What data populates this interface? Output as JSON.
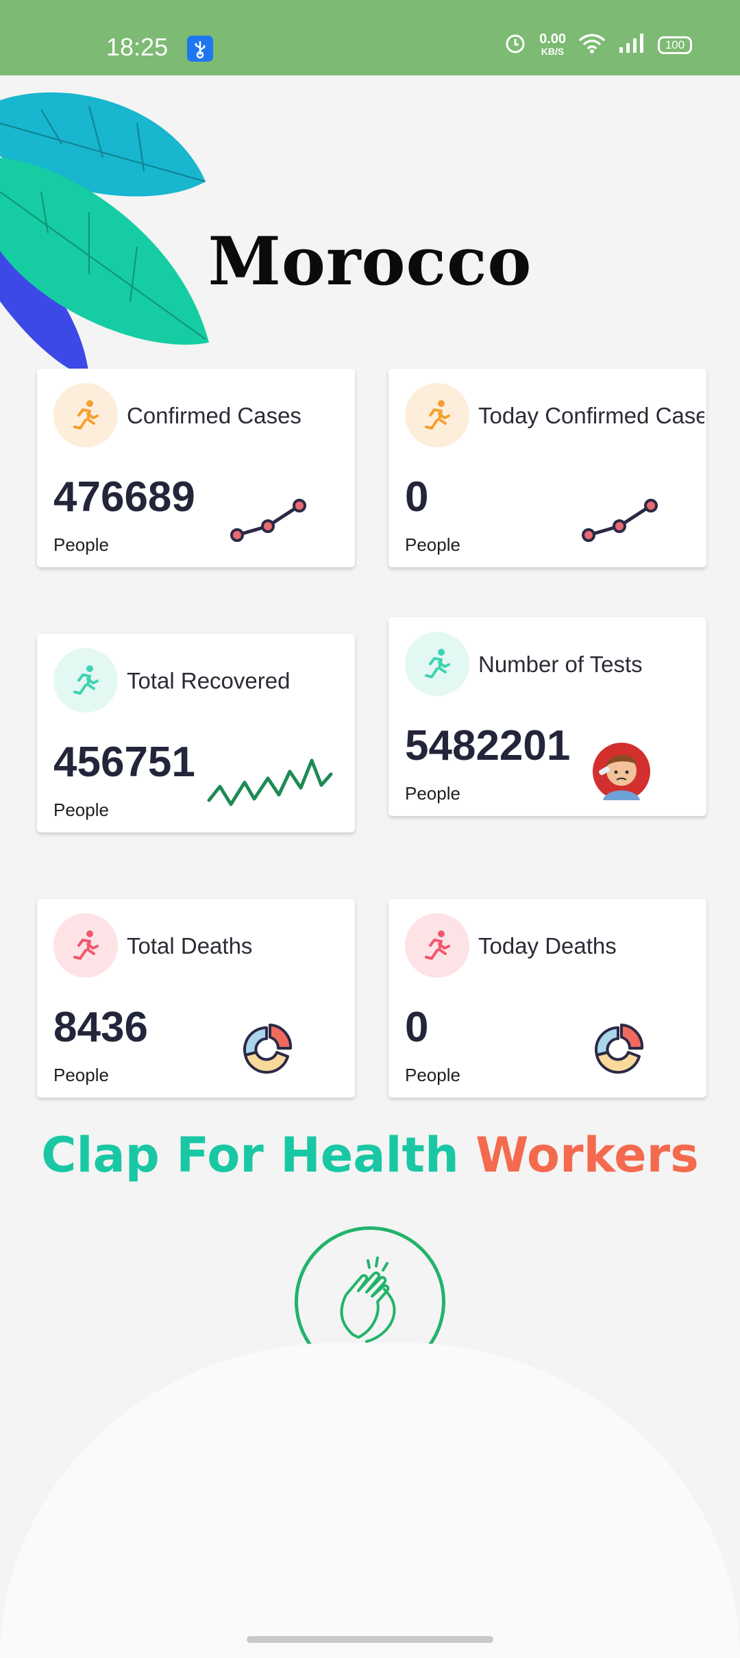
{
  "status_bar": {
    "time": "18:25",
    "speed_value": "0.00",
    "speed_unit": "KB/S",
    "battery": "100",
    "icons": [
      "usb-debug-icon",
      "alarm-icon",
      "wifi-icon",
      "signal-icon",
      "battery-icon"
    ]
  },
  "page": {
    "country": "Morocco"
  },
  "cards": [
    {
      "title": "Confirmed Cases",
      "value": "476689",
      "unit": "People",
      "icon": "runner-icon",
      "accent": "#f5a031",
      "tint": "#fdeedb"
    },
    {
      "title": "Today Confirmed Cases",
      "value": "0",
      "unit": "People",
      "icon": "runner-icon",
      "accent": "#f5a031",
      "tint": "#fdeedb"
    },
    {
      "title": "Total Recovered",
      "value": "456751",
      "unit": "People",
      "icon": "runner-icon",
      "accent": "#3fd2b3",
      "tint": "#e3f8f3"
    },
    {
      "title": "Number of Tests",
      "value": "5482201",
      "unit": "People",
      "icon": "runner-icon",
      "accent": "#3fd2b3",
      "tint": "#e3f8f3"
    },
    {
      "title": "Total Deaths",
      "value": "8436",
      "unit": "People",
      "icon": "runner-icon",
      "accent": "#f2566f",
      "tint": "#fde3e6"
    },
    {
      "title": "Today Deaths",
      "value": "0",
      "unit": "People",
      "icon": "runner-icon",
      "accent": "#f2566f",
      "tint": "#fde3e6"
    }
  ],
  "clap": {
    "part1": "Clap For Health",
    "part2": "Workers",
    "color1": "#1ac7a4",
    "color2": "#f46a4e",
    "button_icon": "clapping-hands-icon"
  }
}
